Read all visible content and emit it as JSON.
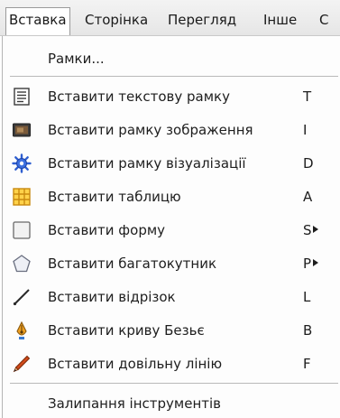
{
  "menubar": {
    "items": [
      "Вставка",
      "Сторінка",
      "Перегляд",
      "Інше",
      "С"
    ]
  },
  "menu": {
    "frames": "Рамки...",
    "items": [
      {
        "label": "Вставити текстову рамку",
        "shortcut": "T",
        "submenu": false,
        "icon": "text-frame-icon"
      },
      {
        "label": "Вставити рамку зображення",
        "shortcut": "I",
        "submenu": false,
        "icon": "image-frame-icon"
      },
      {
        "label": "Вставити рамку візуалізації",
        "shortcut": "D",
        "submenu": false,
        "icon": "render-frame-icon"
      },
      {
        "label": "Вставити таблицю",
        "shortcut": "A",
        "submenu": false,
        "icon": "table-icon"
      },
      {
        "label": "Вставити форму",
        "shortcut": "S",
        "submenu": true,
        "icon": "shape-icon"
      },
      {
        "label": "Вставити багатокутник",
        "shortcut": "P",
        "submenu": true,
        "icon": "polygon-icon"
      },
      {
        "label": "Вставити відрізок",
        "shortcut": "L",
        "submenu": false,
        "icon": "line-icon"
      },
      {
        "label": "Вставити криву Безьє",
        "shortcut": "B",
        "submenu": false,
        "icon": "bezier-pen-icon"
      },
      {
        "label": "Вставити довільну лінію",
        "shortcut": "F",
        "submenu": false,
        "icon": "pencil-icon"
      }
    ],
    "sticky_tools": "Залипання інструментів"
  },
  "colors": {
    "menubar_bg": "#e9e9e9",
    "menu_bg": "#fdfdfd",
    "separator": "#b9b9b9",
    "text": "#1e1e1e"
  }
}
